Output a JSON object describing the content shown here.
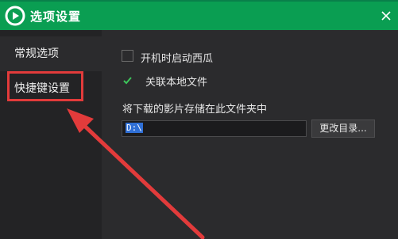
{
  "window": {
    "title": "选项设置"
  },
  "sidebar": {
    "items": [
      {
        "label": "常规选项"
      },
      {
        "label": "快捷键设置"
      }
    ]
  },
  "general": {
    "autostart_label": "开机时启动西瓜",
    "autostart_checked": false,
    "associate_label": "关联本地文件",
    "associate_checked": true,
    "download_folder_label": "将下载的影片存储在此文件夹中",
    "download_path": "D:\\",
    "change_dir_label": "更改目录..."
  },
  "colors": {
    "titlebar": "#0a9e52",
    "annotation": "#e23b3b",
    "selection": "#2f6fd6"
  }
}
